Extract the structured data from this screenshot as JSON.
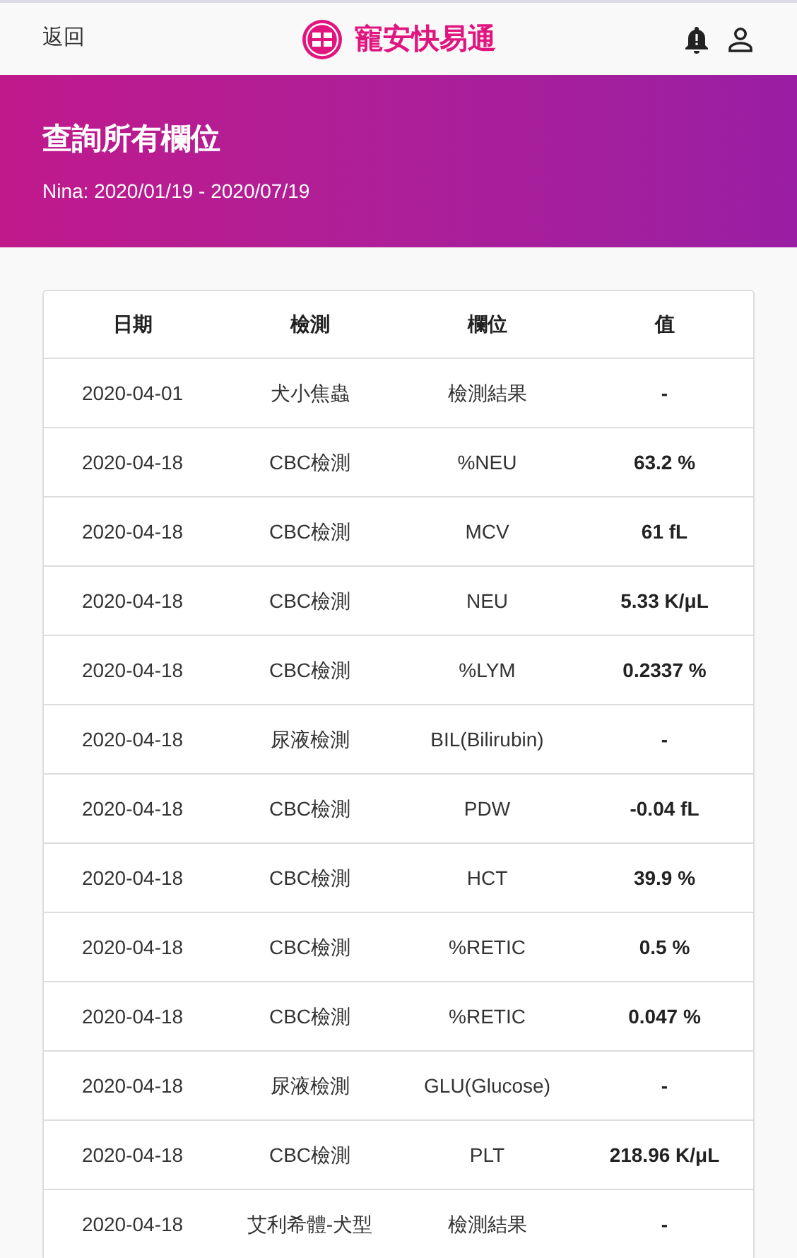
{
  "header": {
    "back": "返回",
    "brand": "寵安快易通"
  },
  "banner": {
    "title": "查詢所有欄位",
    "subtitle": "Nina: 2020/01/19 - 2020/07/19"
  },
  "table": {
    "columns": [
      "日期",
      "檢測",
      "欄位",
      "值"
    ],
    "rows": [
      [
        "2020-04-01",
        "犬小焦蟲",
        "檢測結果",
        "-"
      ],
      [
        "2020-04-18",
        "CBC檢測",
        "%NEU",
        "63.2 %"
      ],
      [
        "2020-04-18",
        "CBC檢測",
        "MCV",
        "61 fL"
      ],
      [
        "2020-04-18",
        "CBC檢測",
        "NEU",
        "5.33 K/μL"
      ],
      [
        "2020-04-18",
        "CBC檢測",
        "%LYM",
        "0.2337 %"
      ],
      [
        "2020-04-18",
        "尿液檢測",
        "BIL(Bilirubin)",
        "-"
      ],
      [
        "2020-04-18",
        "CBC檢測",
        "PDW",
        "-0.04 fL"
      ],
      [
        "2020-04-18",
        "CBC檢測",
        "HCT",
        "39.9 %"
      ],
      [
        "2020-04-18",
        "CBC檢測",
        "%RETIC",
        "0.5 %"
      ],
      [
        "2020-04-18",
        "CBC檢測",
        "%RETIC",
        "0.047 %"
      ],
      [
        "2020-04-18",
        "尿液檢測",
        "GLU(Glucose)",
        "-"
      ],
      [
        "2020-04-18",
        "CBC檢測",
        "PLT",
        "218.96 K/μL"
      ],
      [
        "2020-04-18",
        "艾利希體-犬型",
        "檢測結果",
        "-"
      ]
    ]
  }
}
